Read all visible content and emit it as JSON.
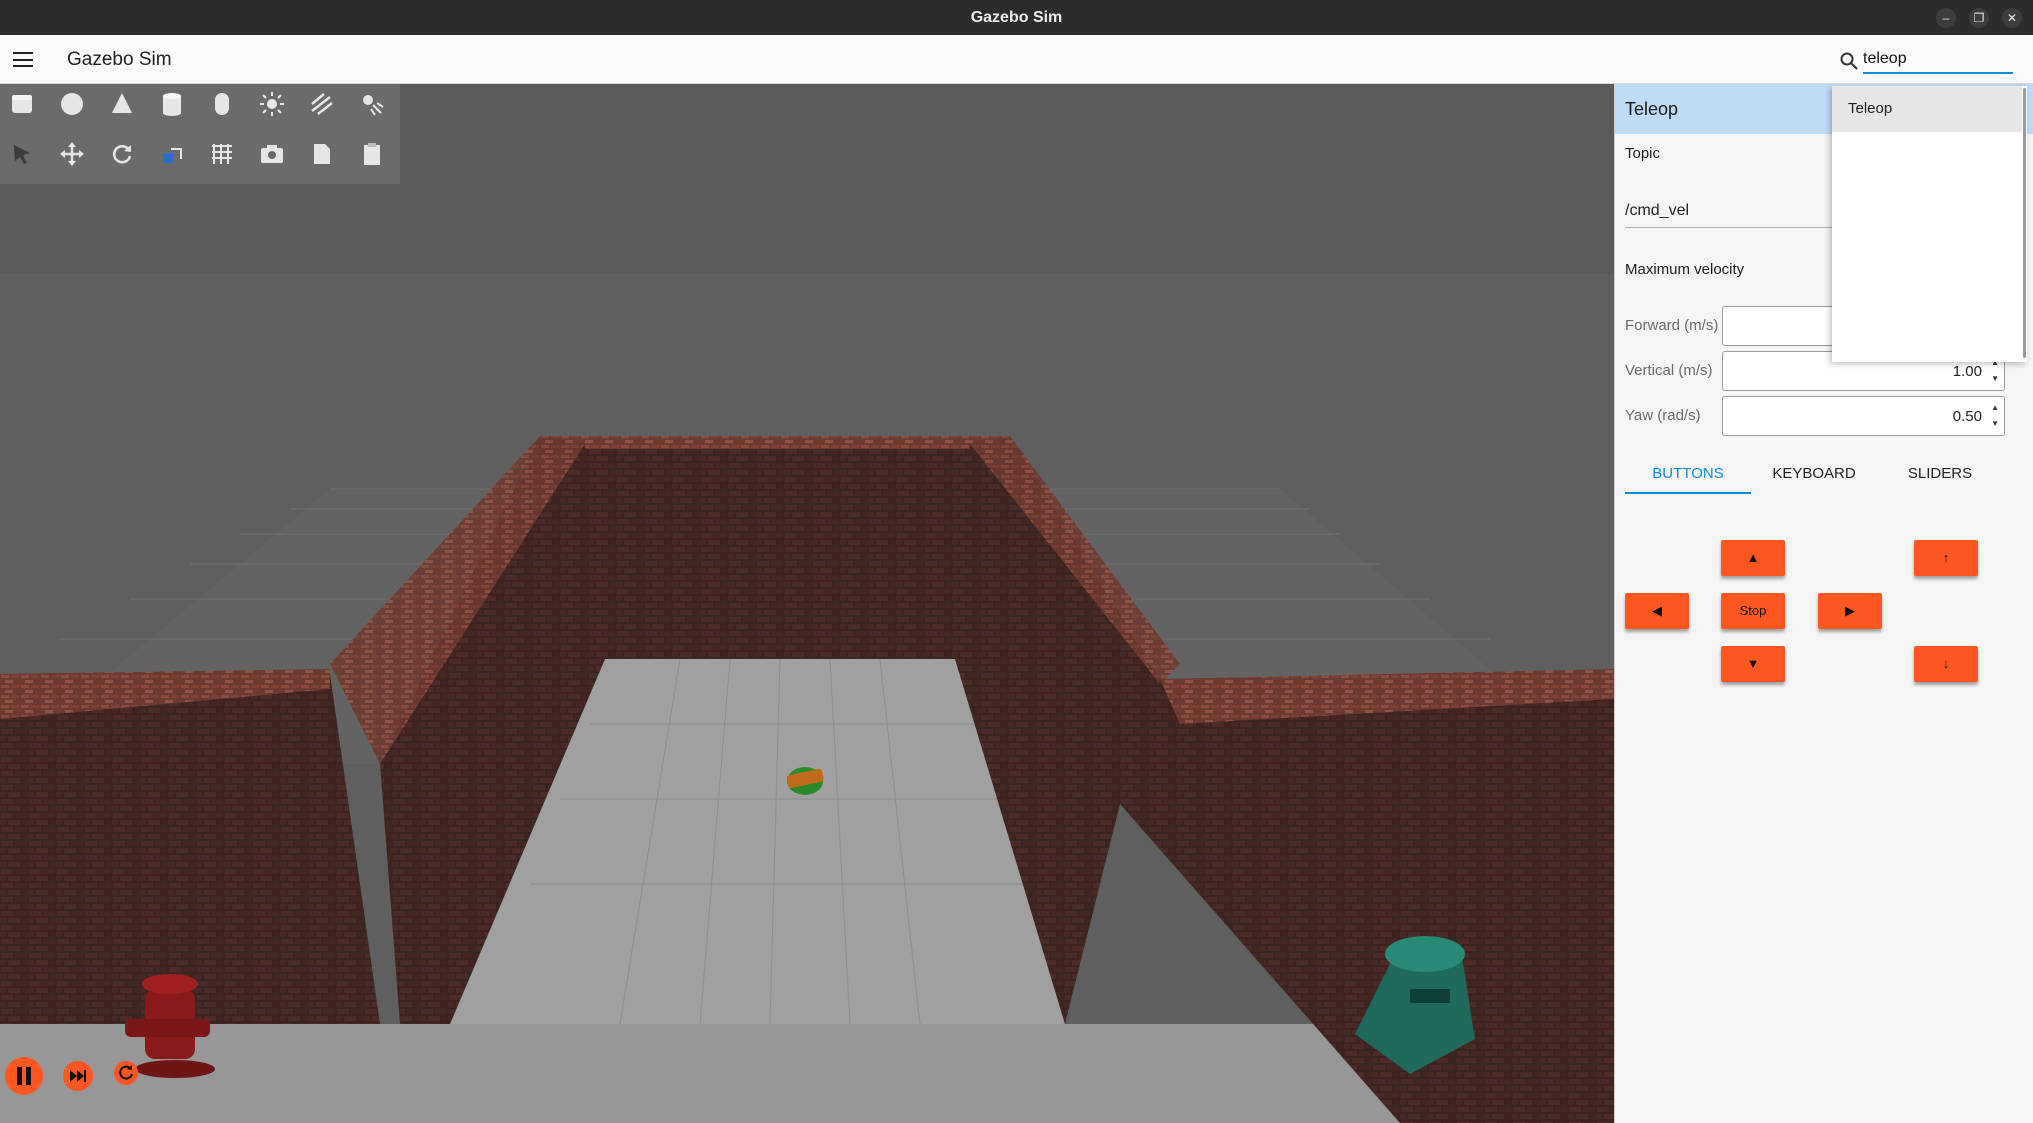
{
  "window": {
    "title": "Gazebo Sim",
    "controls": [
      "minimize",
      "restore",
      "close"
    ]
  },
  "appbar": {
    "title": "Gazebo Sim"
  },
  "search": {
    "value": "teleop",
    "results": [
      "Teleop"
    ]
  },
  "toolbar": {
    "row1": [
      "box-icon",
      "sphere-icon",
      "cone-icon",
      "cylinder-icon",
      "capsule-icon",
      "sun-light-icon",
      "directional-light-icon",
      "spot-light-icon"
    ],
    "row2": [
      "select-icon",
      "translate-icon",
      "rotate-icon",
      "transform-control-icon",
      "grid-snap-icon",
      "screenshot-icon",
      "copy-icon",
      "paste-icon"
    ]
  },
  "playback": [
    "pause-icon",
    "step-icon",
    "reset-icon"
  ],
  "teleop": {
    "title": "Teleop",
    "topic_label": "Topic",
    "topic_value": "/cmd_vel",
    "max_velocity_label": "Maximum velocity",
    "forward_label": "Forward (m/s)",
    "forward_value": "",
    "vertical_label": "Vertical (m/s)",
    "vertical_value": "1.00",
    "yaw_label": "Yaw (rad/s)",
    "yaw_value": "0.50",
    "tabs": [
      "BUTTONS",
      "KEYBOARD",
      "SLIDERS"
    ],
    "active_tab": "BUTTONS",
    "buttons": {
      "forward": "▲",
      "left": "◀",
      "stop": "Stop",
      "right": "▶",
      "backward": "▼",
      "up": "↑",
      "down": "↓"
    }
  },
  "colors": {
    "accent": "#0b8fd9",
    "button": "#ff5722",
    "panel_header": "#bfdcf7"
  }
}
